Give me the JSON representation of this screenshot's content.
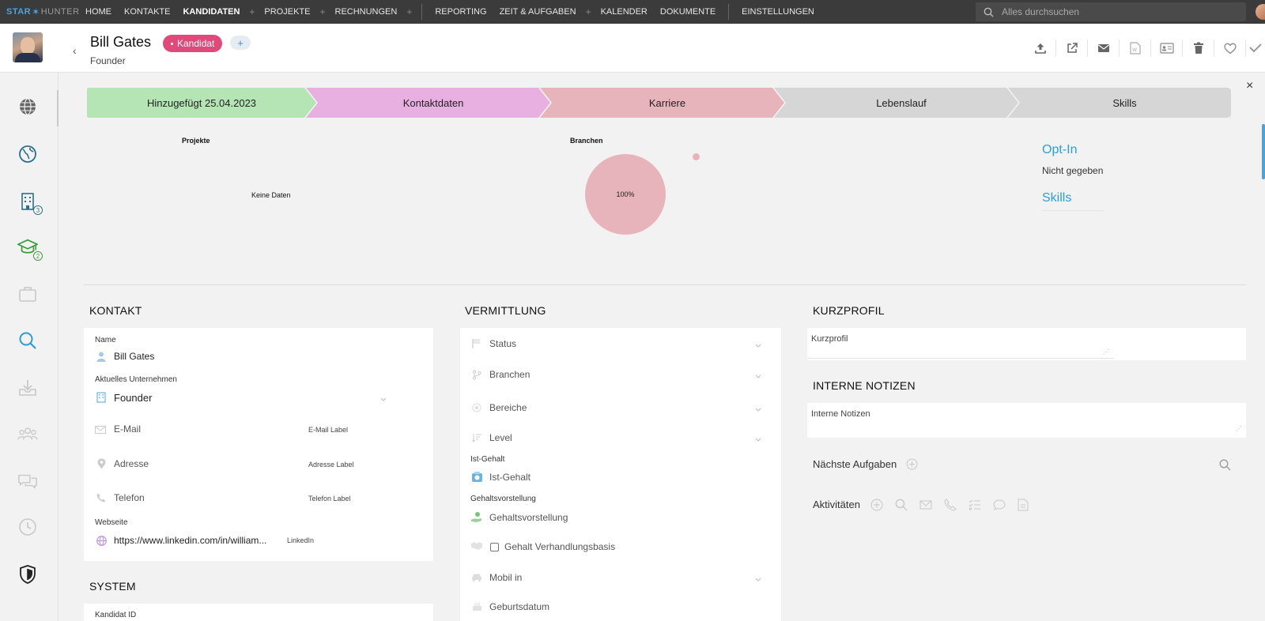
{
  "brand": {
    "star": "STAR",
    "hunter": "HUNTER"
  },
  "nav": {
    "home": "HOME",
    "kontakte": "KONTAKTE",
    "kandidaten": "KANDIDATEN",
    "projekte": "PROJEKTE",
    "rechnungen": "RECHNUNGEN",
    "reporting": "REPORTING",
    "zeit": "ZEIT & AUFGABEN",
    "kalender": "KALENDER",
    "dokumente": "DOKUMENTE",
    "einstellungen": "EINSTELLUNGEN",
    "plus": "+"
  },
  "search": {
    "placeholder": "Alles durchsuchen"
  },
  "header": {
    "name": "Bill Gates",
    "tag": "Kandidat",
    "tag_add": "+",
    "role": "Founder",
    "back": "‹"
  },
  "close": "×",
  "pipeline": {
    "steps": [
      {
        "label": "Hinzugefügt 25.04.2023",
        "color": "#b5e5b5"
      },
      {
        "label": "Kontaktdaten",
        "color": "#e8b0e0"
      },
      {
        "label": "Karriere",
        "color": "#e8b4bc"
      },
      {
        "label": "Lebenslauf",
        "color": "#d6d6d6"
      },
      {
        "label": "Skills",
        "color": "#d6d6d6"
      }
    ]
  },
  "charts": {
    "projekte_title": "Projekte",
    "projekte_empty": "Keine Daten",
    "branchen_title": "Branchen"
  },
  "chart_data": {
    "type": "pie",
    "title": "Branchen",
    "slices": [
      {
        "label": "100%",
        "value": 100,
        "color": "#e8b4bc"
      }
    ]
  },
  "optin": {
    "title": "Opt-In",
    "value": "Nicht gegeben"
  },
  "skills": {
    "title": "Skills"
  },
  "kontakt": {
    "title": "KONTAKT",
    "name_label": "Name",
    "name_value": "Bill Gates",
    "company_label": "Aktuelles Unternehmen",
    "company_value": "Founder",
    "email": "E-Mail",
    "email_label": "E-Mail Label",
    "address": "Adresse",
    "address_label": "Adresse Label",
    "phone": "Telefon",
    "phone_label": "Telefon Label",
    "website_label": "Webseite",
    "website_value": "https://www.linkedin.com/in/william...",
    "website_tag": "LinkedIn"
  },
  "system": {
    "title": "SYSTEM",
    "id_label": "Kandidat ID"
  },
  "vermittlung": {
    "title": "VERMITTLUNG",
    "status": "Status",
    "branchen": "Branchen",
    "bereiche": "Bereiche",
    "level": "Level",
    "ist_label": "Ist-Gehalt",
    "ist_value": "Ist-Gehalt",
    "vorstellung_label": "Gehaltsvorstellung",
    "vorstellung_value": "Gehaltsvorstellung",
    "verhandlung": "Gehalt Verhandlungsbasis",
    "mobil": "Mobil in",
    "geburtsdatum": "Geburtsdatum"
  },
  "kurzprofil": {
    "title": "KURZPROFIL",
    "placeholder": "Kurzprofil"
  },
  "notizen": {
    "title": "INTERNE NOTIZEN",
    "placeholder": "Interne Notizen"
  },
  "aufgaben": {
    "label": "Nächste Aufgaben"
  },
  "aktivitaeten": {
    "label": "Aktivitäten"
  },
  "rail_badges": {
    "companies": "3",
    "education": "2"
  }
}
